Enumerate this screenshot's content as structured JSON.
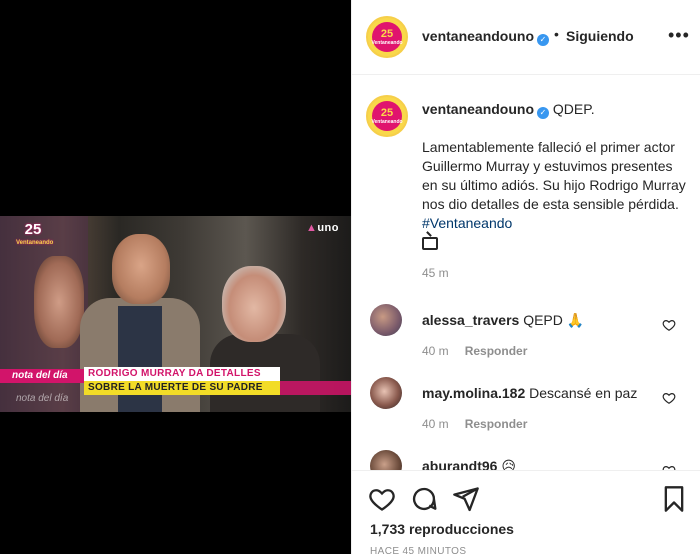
{
  "video": {
    "channel_logo_number": "25",
    "channel_logo_subtitle": "Ventaneando",
    "network_logo": "uno",
    "nota_tag": "nota del día",
    "nota_tag_repeat": "nota del día",
    "headline_line1": "RODRIGO MURRAY DA DETALLES",
    "headline_line2": "SOBRE LA MUERTE DE SU PADRE"
  },
  "header": {
    "username": "ventaneandouno",
    "separator": "•",
    "follow_status": "Siguiendo",
    "more": "•••",
    "avatar_text": "Ventaneando"
  },
  "caption": {
    "username": "ventaneandouno",
    "first_line": "QDEP.",
    "body": "Lamentablemente falleció el primer actor Guillermo Murray y estuvimos presentes en su último adiós. Su hijo Rodrigo Murray nos dio detalles de esta sensible pérdida.",
    "hashtag": "#Ventaneando",
    "time": "45 m"
  },
  "comments": [
    {
      "username": "alessa_travers",
      "text": "QEPD 🙏",
      "time": "40 m",
      "reply": "Responder"
    },
    {
      "username": "may.molina.182",
      "text": "Descansé en paz",
      "time": "40 m",
      "reply": "Responder"
    },
    {
      "username": "aburandt96",
      "text": "😥",
      "time": "",
      "reply": ""
    }
  ],
  "actions": {
    "views_count": "1,733",
    "views_label": "reproducciones",
    "time_ago": "HACE 45 MINUTOS"
  },
  "colors": {
    "accent_pink": "#d2146a",
    "accent_yellow": "#f2dc27",
    "verified_blue": "#3897f0",
    "hashtag_blue": "#00376b"
  }
}
